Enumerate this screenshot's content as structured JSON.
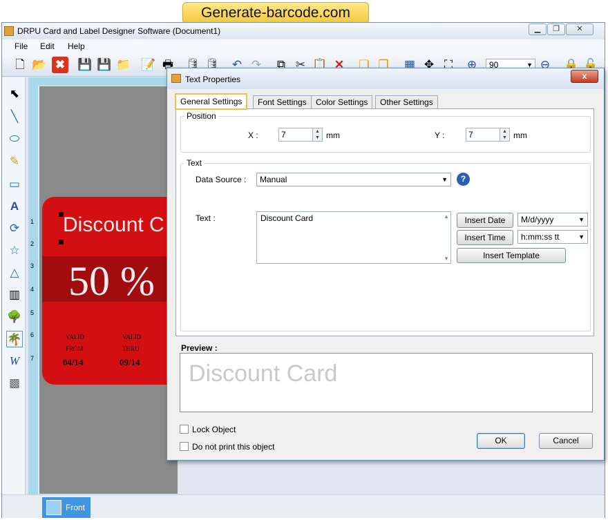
{
  "banner": "Generate-barcode.com",
  "app": {
    "title": "DRPU Card and Label Designer Software  (Document1)"
  },
  "menu": [
    "File",
    "Edit",
    "Help"
  ],
  "zoom": "90",
  "ruler_numbers": [
    "1",
    "2",
    "3",
    "4",
    "5",
    "6",
    "7"
  ],
  "card": {
    "title": "Discount C",
    "percent": "50 %",
    "valid_from_1": "VALID",
    "valid_from_2": "FROM",
    "valid_from_date": "04/14",
    "valid_thru_1": "VALID",
    "valid_thru_2": "THRU",
    "valid_thru_date": "09/14"
  },
  "bottom": {
    "front_tab": "Front"
  },
  "dialog": {
    "title": "Text Properties",
    "close": "x",
    "tabs": [
      "General Settings",
      "Font Settings",
      "Color Settings",
      "Other Settings"
    ],
    "position": {
      "label": "Position",
      "x_label": "X :",
      "x_value": "7",
      "x_unit": "mm",
      "y_label": "Y :",
      "y_value": "7",
      "y_unit": "mm"
    },
    "text_group": {
      "label": "Text",
      "data_source_label": "Data Source :",
      "data_source_value": "Manual",
      "text_label": "Text :",
      "text_value": "Discount Card",
      "insert_date": "Insert Date",
      "date_format": "M/d/yyyy",
      "insert_time": "Insert Time",
      "time_format": "h:mm:ss tt",
      "insert_template": "Insert Template"
    },
    "preview_label": "Preview :",
    "preview_text": "Discount Card",
    "lock_object": "Lock Object",
    "no_print": "Do not print this object",
    "ok": "OK",
    "cancel": "Cancel"
  },
  "colors": {
    "card_red": "#d40f12",
    "card_dark": "#a30c0e",
    "front_tab": "#3e95e0"
  }
}
